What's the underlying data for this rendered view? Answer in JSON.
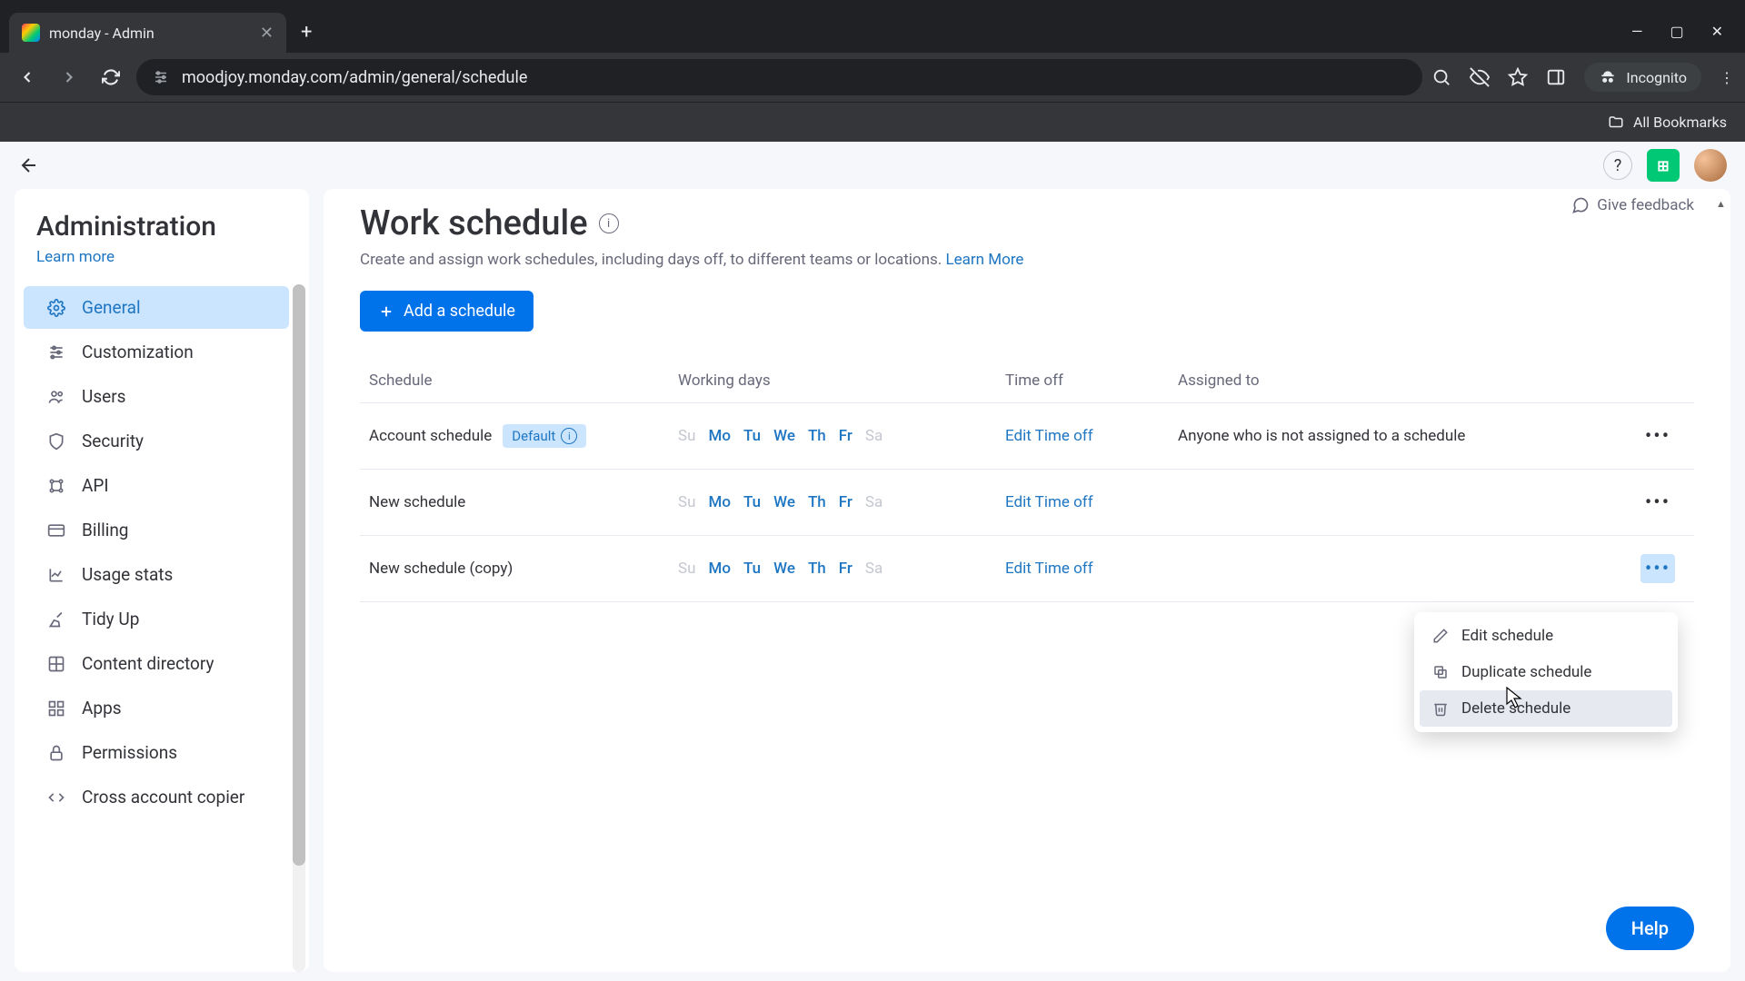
{
  "browser": {
    "tab_title": "monday - Admin",
    "url": "moodjoy.monday.com/admin/general/schedule",
    "incognito_label": "Incognito",
    "bookmarks_label": "All Bookmarks"
  },
  "sidebar": {
    "title": "Administration",
    "learn_more": "Learn more",
    "items": [
      {
        "label": "General",
        "icon": "gear"
      },
      {
        "label": "Customization",
        "icon": "sliders"
      },
      {
        "label": "Users",
        "icon": "users"
      },
      {
        "label": "Security",
        "icon": "shield"
      },
      {
        "label": "API",
        "icon": "api"
      },
      {
        "label": "Billing",
        "icon": "card"
      },
      {
        "label": "Usage stats",
        "icon": "chart"
      },
      {
        "label": "Tidy Up",
        "icon": "broom"
      },
      {
        "label": "Content directory",
        "icon": "grid"
      },
      {
        "label": "Apps",
        "icon": "apps"
      },
      {
        "label": "Permissions",
        "icon": "lock"
      },
      {
        "label": "Cross account copier",
        "icon": "copy"
      }
    ]
  },
  "main": {
    "title": "Work schedule",
    "subtitle_text": "Create and assign work schedules, including days off, to different teams or locations. ",
    "subtitle_link": "Learn More",
    "feedback_label": "Give feedback",
    "add_button": "Add a schedule",
    "columns": {
      "c1": "Schedule",
      "c2": "Working days",
      "c3": "Time off",
      "c4": "Assigned to"
    },
    "days_short": [
      "Su",
      "Mo",
      "Tu",
      "We",
      "Th",
      "Fr",
      "Sa"
    ],
    "rows": [
      {
        "name": "Account schedule",
        "default_badge": "Default",
        "working": [
          false,
          true,
          true,
          true,
          true,
          true,
          false
        ],
        "timeoff": "Edit Time off",
        "assigned": "Anyone who is not assigned to a schedule"
      },
      {
        "name": "New schedule",
        "working": [
          false,
          true,
          true,
          true,
          true,
          true,
          false
        ],
        "timeoff": "Edit Time off",
        "assigned": ""
      },
      {
        "name": "New schedule (copy)",
        "working": [
          false,
          true,
          true,
          true,
          true,
          true,
          false
        ],
        "timeoff": "Edit Time off",
        "assigned": ""
      }
    ],
    "dropdown": {
      "edit": "Edit schedule",
      "duplicate": "Duplicate schedule",
      "delete": "Delete schedule"
    },
    "help_label": "Help"
  }
}
